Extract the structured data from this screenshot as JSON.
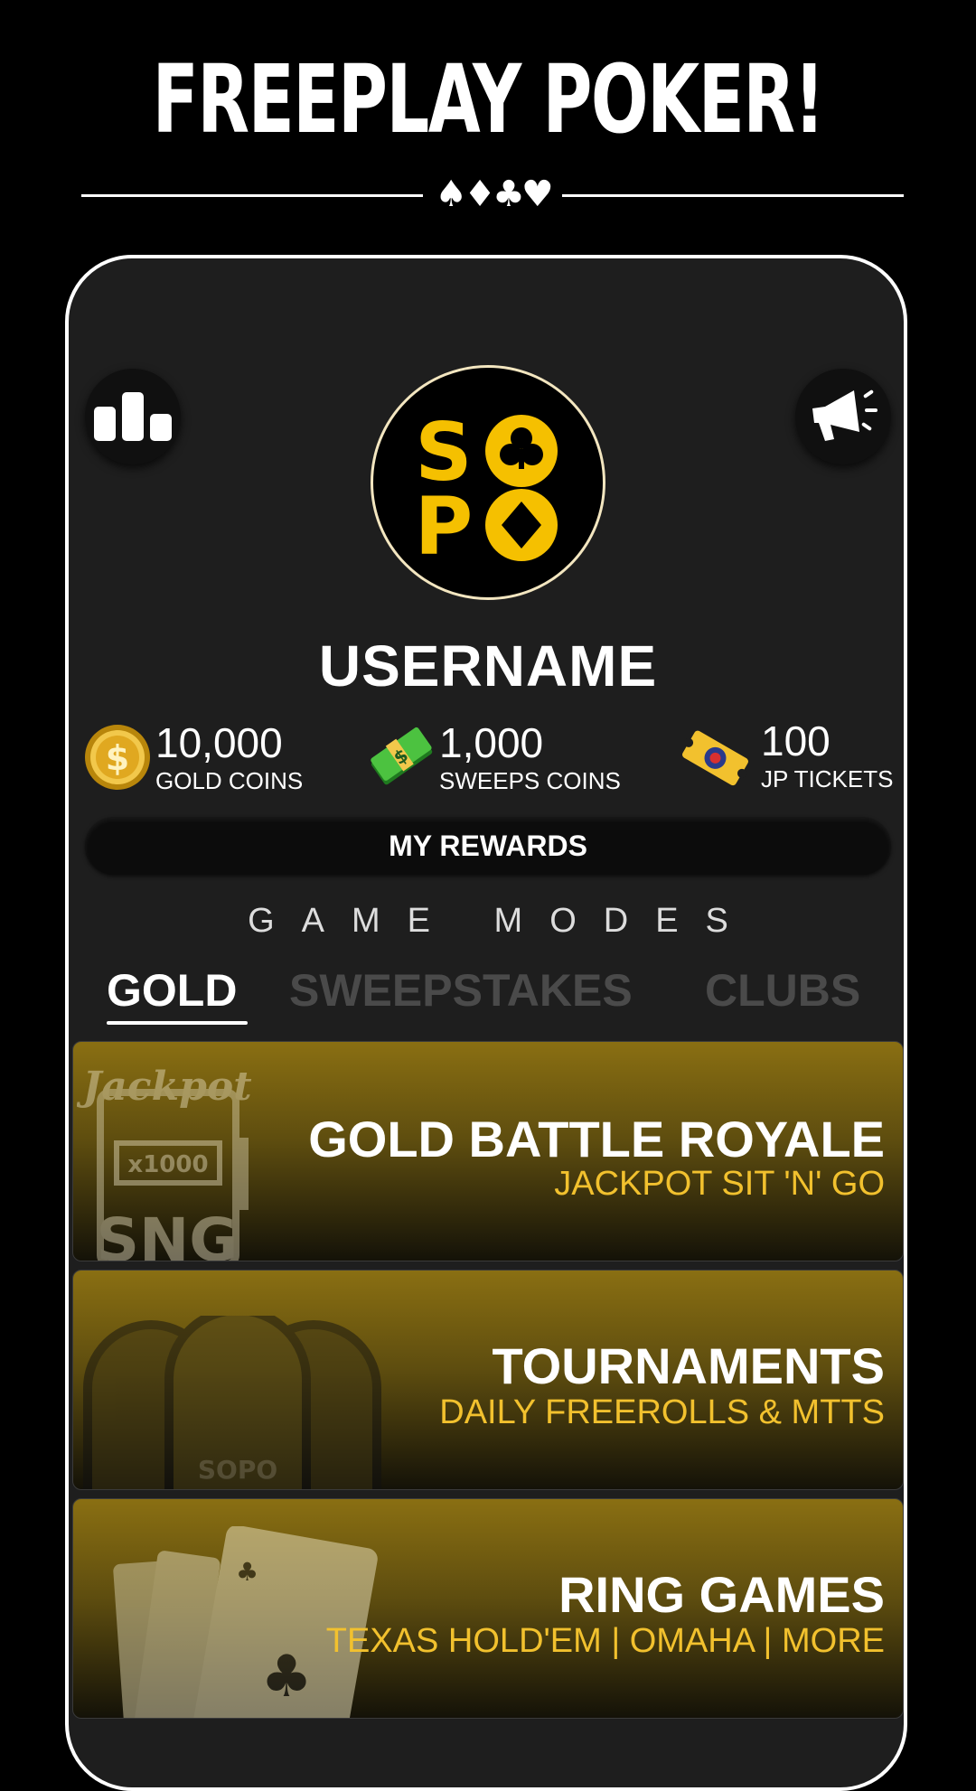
{
  "header": {
    "title": "FREEPLAY POKER!",
    "suits": "♠♦♣♥"
  },
  "profile": {
    "logo_letters": [
      "S",
      "P"
    ],
    "username": "USERNAME"
  },
  "stats": [
    {
      "value": "10,000",
      "label": "GOLD COINS",
      "icon": "gold-coin-icon"
    },
    {
      "value": "1,000",
      "label": "SWEEPS COINS",
      "icon": "cash-stack-icon"
    },
    {
      "value": "100",
      "label": "JP TICKETS",
      "icon": "ticket-icon"
    }
  ],
  "rewards_label": "MY REWARDS",
  "game_modes": {
    "title": "GAME MODES",
    "tabs": [
      {
        "label": "GOLD",
        "active": true
      },
      {
        "label": "SWEEPSTAKES",
        "active": false
      },
      {
        "label": "CLUBS",
        "active": false
      }
    ]
  },
  "cards": [
    {
      "title": "GOLD BATTLE ROYALE",
      "subtitle": "JACKPOT SIT 'N' GO",
      "art": "slot-machine-icon",
      "art_text": [
        "Jackpot",
        "x1000",
        "SNG"
      ]
    },
    {
      "title": "TOURNAMENTS",
      "subtitle": "DAILY FREEROLLS & MTTS",
      "art": "tournament-tables-icon",
      "art_text": "SOPO"
    },
    {
      "title": "RING GAMES",
      "subtitle": "TEXAS HOLD'EM | OMAHA | MORE",
      "art": "playing-cards-icon"
    }
  ],
  "colors": {
    "accent_gold": "#f2c12e",
    "logo_yellow": "#f5c000",
    "panel_bg": "#1e1e1e",
    "inactive_tab": "#4a4a4a"
  }
}
